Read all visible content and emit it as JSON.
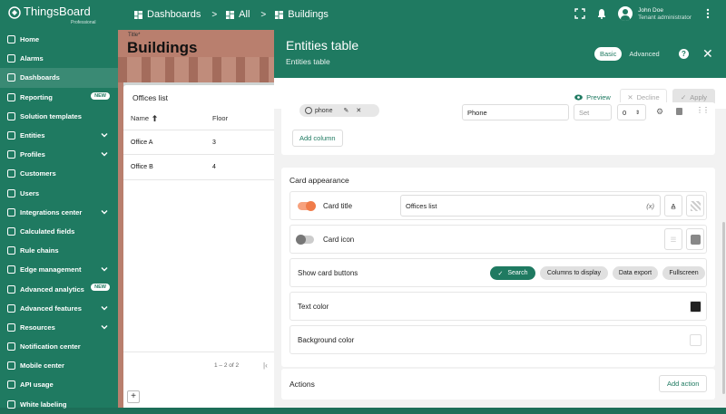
{
  "app": {
    "name": "ThingsBoard",
    "edition": "Professional"
  },
  "breadcrumb": [
    {
      "label": "Dashboards"
    },
    {
      "label": "All"
    },
    {
      "label": "Buildings"
    }
  ],
  "user": {
    "name": "John Doe",
    "role": "Tenant administrator"
  },
  "sidebar": {
    "items": [
      {
        "label": "Home",
        "icon": "home-icon"
      },
      {
        "label": "Alarms",
        "icon": "alarm-icon"
      },
      {
        "label": "Dashboards",
        "icon": "dashboard-icon",
        "active": true
      },
      {
        "label": "Reporting",
        "icon": "report-icon",
        "badge": "NEW"
      },
      {
        "label": "Solution templates",
        "icon": "template-icon"
      },
      {
        "label": "Entities",
        "icon": "entities-icon",
        "expand": true
      },
      {
        "label": "Profiles",
        "icon": "profiles-icon",
        "expand": true
      },
      {
        "label": "Customers",
        "icon": "customers-icon"
      },
      {
        "label": "Users",
        "icon": "users-icon"
      },
      {
        "label": "Integrations center",
        "icon": "integrations-icon",
        "expand": true
      },
      {
        "label": "Calculated fields",
        "icon": "function-icon"
      },
      {
        "label": "Rule chains",
        "icon": "rule-chain-icon"
      },
      {
        "label": "Edge management",
        "icon": "edge-icon",
        "expand": true
      },
      {
        "label": "Advanced analytics",
        "icon": "analytics-icon",
        "badge": "NEW"
      },
      {
        "label": "Advanced features",
        "icon": "features-icon",
        "expand": true
      },
      {
        "label": "Resources",
        "icon": "resources-icon",
        "expand": true
      },
      {
        "label": "Notification center",
        "icon": "notification-icon"
      },
      {
        "label": "Mobile center",
        "icon": "mobile-icon"
      },
      {
        "label": "API usage",
        "icon": "api-icon"
      },
      {
        "label": "White labeling",
        "icon": "palette-icon"
      }
    ]
  },
  "dashboard": {
    "title_label": "Title*",
    "title": "Buildings",
    "card": {
      "title": "Offices list",
      "columns": [
        "Name",
        "Floor"
      ],
      "rows": [
        {
          "name": "Office A",
          "floor": "3"
        },
        {
          "name": "Office B",
          "floor": "4"
        }
      ],
      "pager": "1 – 2 of 2"
    }
  },
  "panel": {
    "title": "Entities table",
    "subtitle": "Entities table",
    "modes": {
      "basic": "Basic",
      "advanced": "Advanced"
    },
    "actions": {
      "preview": "Preview",
      "decline": "Decline",
      "apply": "Apply"
    },
    "column_row": {
      "chip": "phone",
      "label_value": "Phone",
      "width_placeholder": "Set",
      "order_value": "0"
    },
    "add_column": "Add column",
    "card_appearance": {
      "title": "Card appearance",
      "card_title_label": "Card title",
      "card_title_value": "Offices list",
      "card_title_suffix": "(x)",
      "card_icon_label": "Card icon",
      "show_buttons_label": "Show card buttons",
      "buttons": {
        "search": "Search",
        "columns": "Columns to display",
        "export": "Data export",
        "fullscreen": "Fullscreen"
      },
      "text_color_label": "Text color",
      "background_color_label": "Background color"
    },
    "actions_section": {
      "title": "Actions",
      "add_action": "Add action"
    }
  },
  "colors": {
    "brand": "#1f7a61",
    "toggle_on": "#f07c4a",
    "text_swatch": "#222222",
    "bg_swatch": "#ffffff"
  }
}
